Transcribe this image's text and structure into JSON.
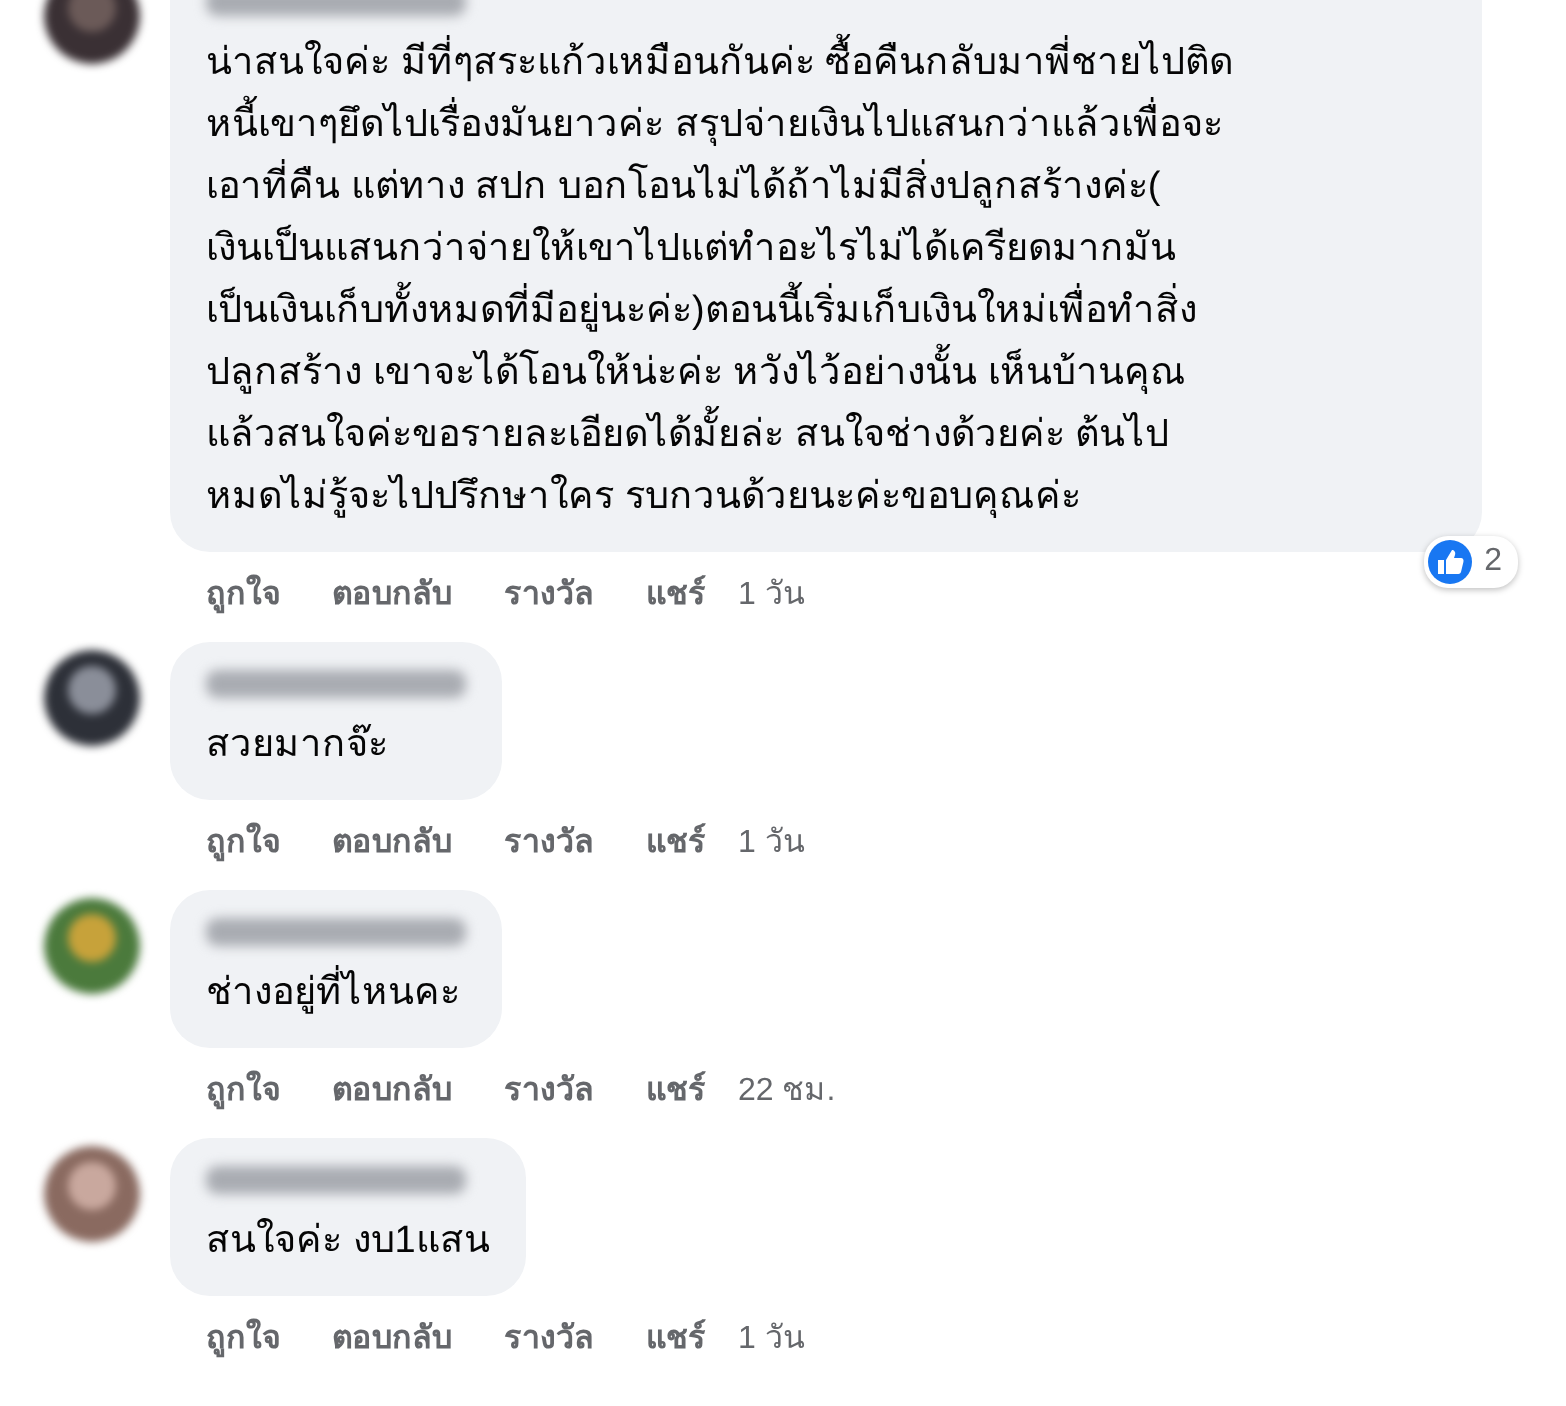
{
  "comments": [
    {
      "text": "น่าสนใจค่ะ มีที่ๆสระแก้วเหมือนกันค่ะ ซื้อคืนกลับมาพี่ชายไปติด\nหนี้เขาๆยึดไปเรื่องมันยาวค่ะ สรุปจ่ายเงินไปแสนกว่าแล้วเพื่อจะ\nเอาที่คืน แต่ทาง สปก บอกโอนไม่ได้ถ้าไม่มีสิ่งปลูกสร้างค่ะ(\nเงินเป็นแสนกว่าจ่ายให้เขาไปแต่ทำอะไรไม่ได้เครียดมากมัน\nเป็นเงินเก็บทั้งหมดที่มีอยู่นะค่ะ)ตอนนี้เริ่มเก็บเงินใหม่เพื่อทำสิ่ง\nปลูกสร้าง เขาจะได้โอนให้น่ะค่ะ หวังไว้อย่างนั้น เห็นบ้านคุณ\nแล้วสนใจค่ะขอรายละเอียดได้มั้ยล่ะ สนใจช่างด้วยค่ะ ต้นไป\nหมดไม่รู้จะไปปรึกษาใคร รบกวนด้วยนะค่ะขอบคุณค่ะ",
      "reactions": "2",
      "actions": [
        "ถูกใจ",
        "ตอบกลับ",
        "รางวัล",
        "แชร์"
      ],
      "time": "1 วัน"
    },
    {
      "text": "สวยมากจ๊ะ",
      "actions": [
        "ถูกใจ",
        "ตอบกลับ",
        "รางวัล",
        "แชร์"
      ],
      "time": "1 วัน"
    },
    {
      "text": "ช่างอยู่ที่ไหนคะ",
      "actions": [
        "ถูกใจ",
        "ตอบกลับ",
        "รางวัล",
        "แชร์"
      ],
      "time": "22 ชม."
    },
    {
      "text": "สนใจค่ะ งบ1แสน",
      "actions": [
        "ถูกใจ",
        "ตอบกลับ",
        "รางวัล",
        "แชร์"
      ],
      "time": "1 วัน"
    }
  ]
}
